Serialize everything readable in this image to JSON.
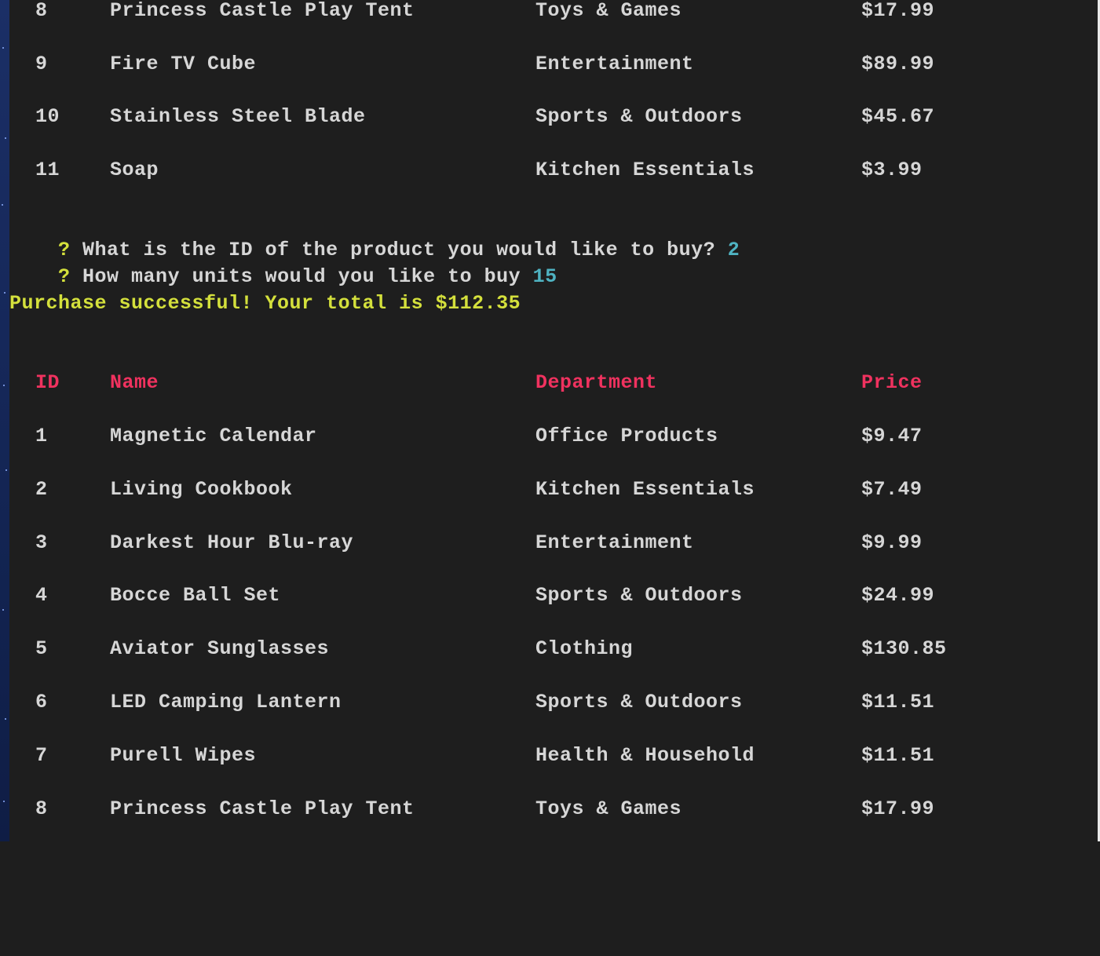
{
  "top_rows": [
    {
      "id": "8",
      "name": "Princess Castle Play Tent",
      "department": "Toys & Games",
      "price": "$17.99"
    },
    {
      "id": "9",
      "name": "Fire TV Cube",
      "department": "Entertainment",
      "price": "$89.99"
    },
    {
      "id": "10",
      "name": "Stainless Steel Blade",
      "department": "Sports & Outdoors",
      "price": "$45.67"
    },
    {
      "id": "11",
      "name": "Soap",
      "department": "Kitchen Essentials",
      "price": "$3.99"
    }
  ],
  "prompts": [
    {
      "mark": "?",
      "question": "What is the ID of the product you would like to buy?",
      "answer": "2"
    },
    {
      "mark": "?",
      "question": "How many units would you like to buy",
      "answer": "15"
    }
  ],
  "success_message": "Purchase successful! Your total is $112.35",
  "table_header": {
    "id": "ID",
    "name": "Name",
    "department": "Department",
    "price": "Price"
  },
  "table_rows": [
    {
      "id": "1",
      "name": "Magnetic Calendar",
      "department": "Office Products",
      "price": "$9.47"
    },
    {
      "id": "2",
      "name": "Living Cookbook",
      "department": "Kitchen Essentials",
      "price": "$7.49"
    },
    {
      "id": "3",
      "name": "Darkest Hour Blu-ray",
      "department": "Entertainment",
      "price": "$9.99"
    },
    {
      "id": "4",
      "name": "Bocce Ball Set",
      "department": "Sports & Outdoors",
      "price": "$24.99"
    },
    {
      "id": "5",
      "name": "Aviator Sunglasses",
      "department": "Clothing",
      "price": "$130.85"
    },
    {
      "id": "6",
      "name": "LED Camping Lantern",
      "department": "Sports & Outdoors",
      "price": "$11.51"
    },
    {
      "id": "7",
      "name": "Purell Wipes",
      "department": "Health & Household",
      "price": "$11.51"
    },
    {
      "id": "8",
      "name": "Princess Castle Play Tent",
      "department": "Toys & Games",
      "price": "$17.99"
    }
  ],
  "colors": {
    "header": "#f0325f",
    "prompt": "#d4e03c",
    "answer": "#4fb3c2",
    "text": "#d6d6d6",
    "background": "#1e1e1e"
  }
}
